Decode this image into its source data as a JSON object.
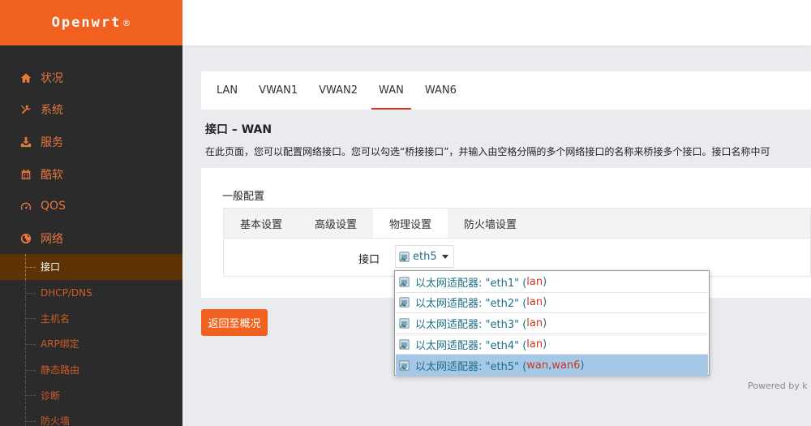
{
  "brand": {
    "name": "Openwrt",
    "reg": "®"
  },
  "sidebar": {
    "items": [
      {
        "label": "状况",
        "icon": "home-icon"
      },
      {
        "label": "系统",
        "icon": "tools-icon"
      },
      {
        "label": "服务",
        "icon": "download-icon"
      },
      {
        "label": "酷软",
        "icon": "calendar-icon"
      },
      {
        "label": "QOS",
        "icon": "gauge-icon"
      },
      {
        "label": "网络",
        "icon": "globe-icon"
      }
    ],
    "sub_items": [
      {
        "label": "接口",
        "active": true
      },
      {
        "label": "DHCP/DNS"
      },
      {
        "label": "主机名"
      },
      {
        "label": "ARP绑定"
      },
      {
        "label": "静态路由"
      },
      {
        "label": "诊断"
      },
      {
        "label": "防火墙"
      }
    ]
  },
  "net_tabs": [
    {
      "label": "LAN"
    },
    {
      "label": "VWAN1"
    },
    {
      "label": "VWAN2"
    },
    {
      "label": "WAN",
      "active": true
    },
    {
      "label": "WAN6"
    }
  ],
  "page": {
    "title": "接口 – WAN",
    "description": "在此页面，您可以配置网络接口。您可以勾选“桥接接口”，并输入由空格分隔的多个网络接口的名称来桥接多个接口。接口名称中可"
  },
  "panel": {
    "title": "一般配置",
    "tabs": [
      {
        "label": "基本设置"
      },
      {
        "label": "高级设置"
      },
      {
        "label": "物理设置",
        "active": true
      },
      {
        "label": "防火墙设置"
      }
    ],
    "field_label": "接口",
    "selected_value": "eth5"
  },
  "dropdown": {
    "items": [
      {
        "prefix": "以太网适配器: \"eth1\" (",
        "nets": [
          "lan"
        ],
        "suffix": ")"
      },
      {
        "prefix": "以太网适配器: \"eth2\" (",
        "nets": [
          "lan"
        ],
        "suffix": ")"
      },
      {
        "prefix": "以太网适配器: \"eth3\" (",
        "nets": [
          "lan"
        ],
        "suffix": ")"
      },
      {
        "prefix": "以太网适配器: \"eth4\" (",
        "nets": [
          "lan"
        ],
        "suffix": ")"
      },
      {
        "prefix": "以太网适配器: \"eth5\" (",
        "nets": [
          "wan",
          "wan6"
        ],
        "suffix": ")",
        "selected": true
      }
    ]
  },
  "back_button": "返回至概况",
  "footer": {
    "credit": "Powered by k"
  },
  "colors": {
    "accent": "#f0601f",
    "sidebar_bg": "#2b2b2b",
    "active_tab_line": "#e0321e",
    "dropdown_selected": "#a6c8e8"
  }
}
